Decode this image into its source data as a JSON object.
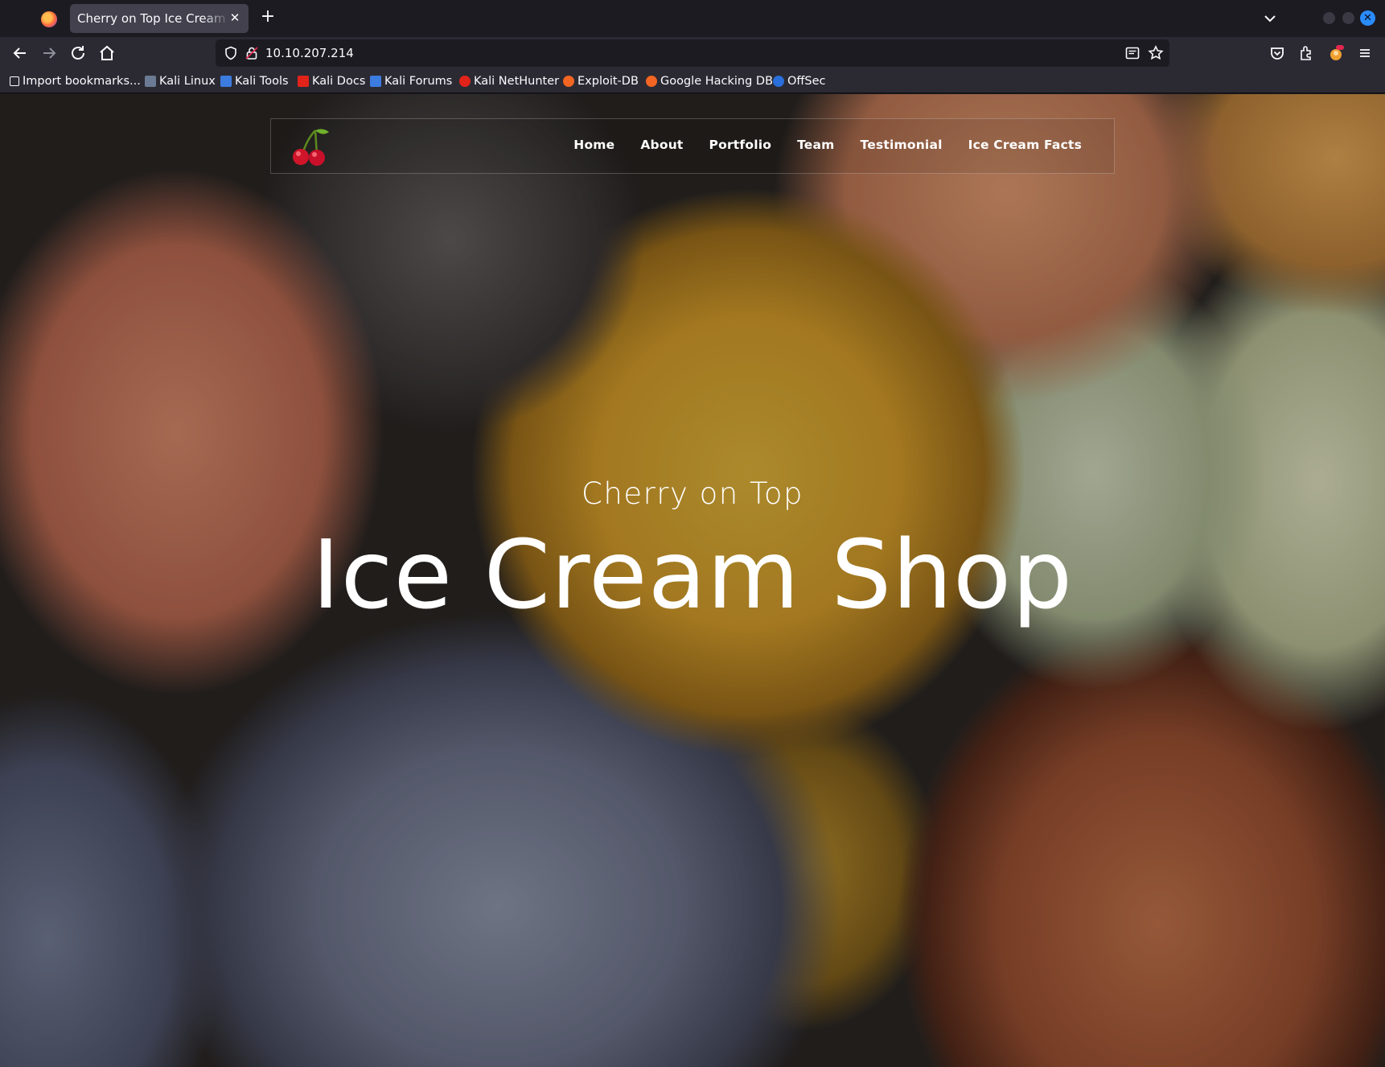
{
  "browser": {
    "tab_title": "Cherry on Top Ice Cream Shop",
    "url": "10.10.207.214",
    "bookmarks": [
      {
        "label": "Import bookmarks...",
        "color": "#fbfbfe"
      },
      {
        "label": "Kali Linux",
        "color": "#6b7b93"
      },
      {
        "label": "Kali Tools",
        "color": "#3c7be0"
      },
      {
        "label": "Kali Docs",
        "color": "#e2231a"
      },
      {
        "label": "Kali Forums",
        "color": "#3c7be0"
      },
      {
        "label": "Kali NetHunter",
        "color": "#e2231a"
      },
      {
        "label": "Exploit-DB",
        "color": "#f26522"
      },
      {
        "label": "Google Hacking DB",
        "color": "#f26522"
      },
      {
        "label": "OffSec",
        "color": "#2a6fdb"
      }
    ]
  },
  "site": {
    "logo_icon": "cherry-icon",
    "menu": [
      "Home",
      "About",
      "Portfolio",
      "Team",
      "Testimonial",
      "Ice Cream Facts"
    ],
    "hero_subtitle": "Cherry on Top",
    "hero_title": "Ice Cream Shop"
  }
}
